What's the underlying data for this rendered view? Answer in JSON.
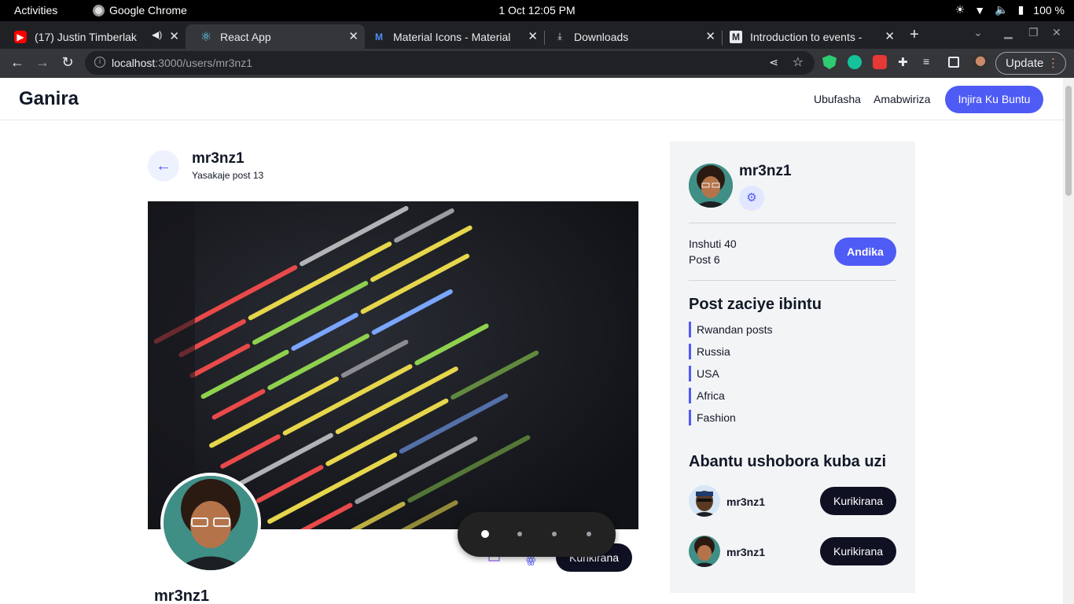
{
  "os": {
    "activities": "Activities",
    "app_name": "Google Chrome",
    "clock": "1 Oct  12:05 PM",
    "battery": "100 %"
  },
  "tabs": [
    {
      "title": "(17) Justin Timberlak",
      "icon": "youtube-icon"
    },
    {
      "title": "React App",
      "icon": "react-icon"
    },
    {
      "title": "Material Icons - Material",
      "icon": "material-icon"
    },
    {
      "title": "Downloads",
      "icon": "download-icon"
    },
    {
      "title": "Introduction to events -",
      "icon": "mdn-icon"
    }
  ],
  "browser": {
    "url_host": "localhost",
    "url_path": ":3000/users/mr3nz1",
    "update_label": "Update"
  },
  "site": {
    "brand": "Ganira",
    "nav_help": "Ubufasha",
    "nav_terms": "Amabwiriza",
    "nav_cta": "Injira Ku Buntu"
  },
  "header": {
    "username": "mr3nz1",
    "subtitle": "Yasakaje post 13"
  },
  "profile": {
    "name": "mr3nz1",
    "follow_label": "Kurikirana"
  },
  "sidebar": {
    "username": "mr3nz1",
    "friends": "Inshuti 40",
    "posts": "Post 6",
    "write_label": "Andika",
    "categories_title": "Post zaciye ibintu",
    "categories": [
      "Rwandan posts",
      "Russia",
      "USA",
      "Africa",
      "Fashion"
    ],
    "suggestions_title": "Abantu ushobora kuba uzi",
    "suggestions": [
      {
        "name": "mr3nz1",
        "button": "Kurikirana"
      },
      {
        "name": "mr3nz1",
        "button": "Kurikirana"
      }
    ]
  },
  "colors": {
    "accent": "#4f5bf5",
    "dark_button": "#0f1123"
  }
}
